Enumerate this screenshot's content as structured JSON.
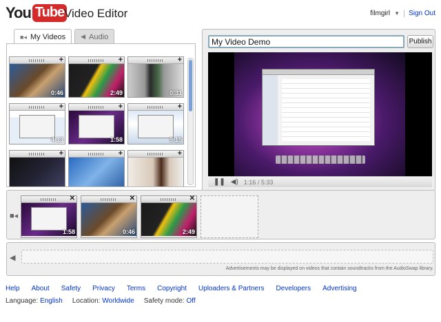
{
  "header": {
    "logo_you": "You",
    "logo_tube": "Tube",
    "app_title": "Video Editor",
    "user_name": "filmgirl",
    "sign_out": "Sign Out"
  },
  "tabs": [
    {
      "label": "My Videos",
      "active": true,
      "icon": "video-camera-icon"
    },
    {
      "label": "Audio",
      "active": false,
      "icon": "speaker-icon"
    }
  ],
  "library": {
    "clips": [
      {
        "duration": "0:46",
        "style": "people"
      },
      {
        "duration": "2:49",
        "style": "colors"
      },
      {
        "duration": "0:31",
        "style": "phone"
      },
      {
        "duration": "4:13",
        "style": "map"
      },
      {
        "duration": "1:58",
        "style": "desk"
      },
      {
        "duration": "9:15",
        "style": "web"
      },
      {
        "duration": "",
        "style": "dark"
      },
      {
        "duration": "",
        "style": "blue"
      },
      {
        "duration": "",
        "style": "woman"
      }
    ]
  },
  "preview": {
    "title_value": "My Video Demo",
    "publish_label": "Publish",
    "time": "1:16 / 5:33",
    "progress": 0.23
  },
  "timeline": {
    "clips": [
      {
        "duration": "1:58",
        "style": "desk"
      },
      {
        "duration": "0:46",
        "style": "people"
      },
      {
        "duration": "2:49",
        "style": "colors"
      }
    ]
  },
  "audio": {
    "note": "Advertisements may be displayed on videos that contain soundtracks from the AudioSwap library."
  },
  "footer": {
    "links": [
      "Help",
      "About",
      "Safety",
      "Privacy",
      "Terms",
      "Copyright",
      "Uploaders & Partners",
      "Developers",
      "Advertising"
    ],
    "language_label": "Language:",
    "language_value": "English",
    "location_label": "Location:",
    "location_value": "Worldwide",
    "safety_label": "Safety mode:",
    "safety_value": "Off"
  }
}
